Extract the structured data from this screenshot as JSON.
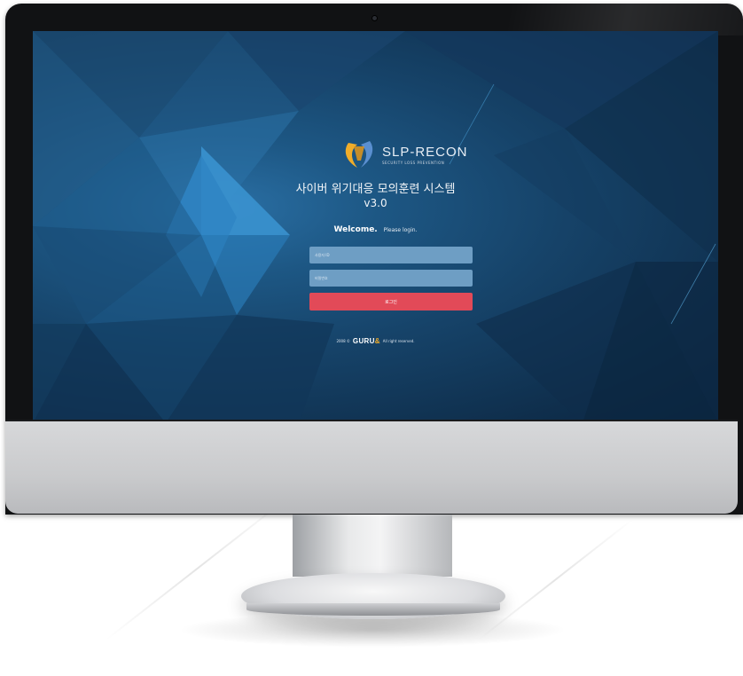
{
  "app": {
    "logo": {
      "title": "SLP-RECON",
      "subtitle": "SECURITY LOSS PREVENTION"
    },
    "system_title": "사이버 위기대응 모의훈련 시스템",
    "version": "v3.0"
  },
  "login": {
    "welcome": "Welcome.",
    "prompt": "Please login.",
    "username_placeholder": "사용자 ID",
    "password_placeholder": "비밀번호",
    "login_button": "로그인"
  },
  "footer": {
    "year_copy": "2008 ©",
    "brand": "GURU",
    "brand_accent": "&",
    "rights": "All right reserved."
  },
  "colors": {
    "screen_bg": "#164369",
    "input_bg": "#6e9ec4",
    "login_button": "#e24a58",
    "logo_accent": "#f0ad2a"
  },
  "icons": {
    "logo": "shield-swoosh-logo-icon",
    "camera": "camera-dot-icon"
  }
}
